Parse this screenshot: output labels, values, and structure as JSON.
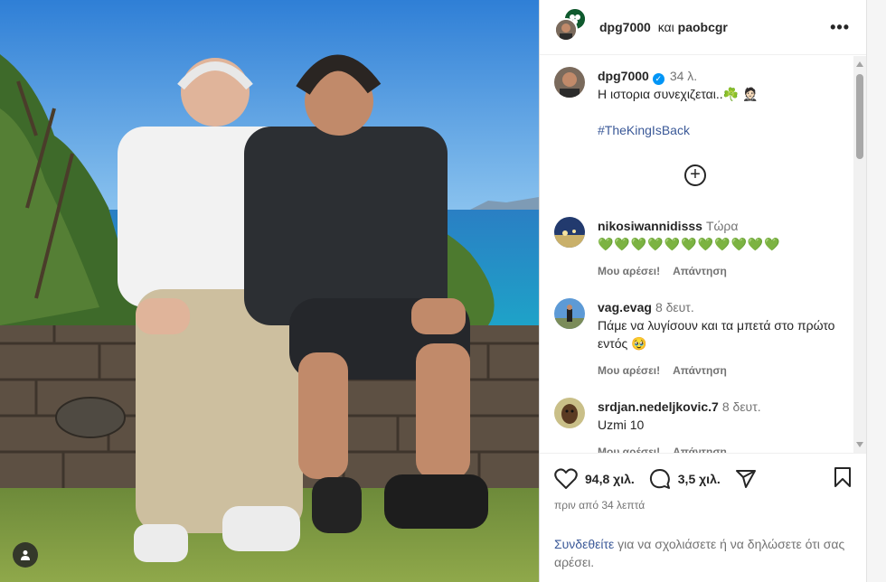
{
  "header": {
    "user1": "dpg7000",
    "conjunction": "και",
    "user2": "paobcgr"
  },
  "caption": {
    "username": "dpg7000",
    "time": "34 λ.",
    "text": "Η ιστορια συνεχιζεται..☘️ 🤵🏻",
    "hashtag": "#TheKingIsBack"
  },
  "comments": [
    {
      "username": "nikosiwannidisss",
      "time": "Τώρα",
      "text": "💚💚💚💚💚💚💚💚💚💚💚",
      "like": "Μου αρέσει!",
      "reply": "Απάντηση"
    },
    {
      "username": "vag.evag",
      "time": "8 δευτ.",
      "text": "Πάμε να λυγίσουν και τα μπετά στο πρώτο εντός 🥹",
      "like": "Μου αρέσει!",
      "reply": "Απάντηση"
    },
    {
      "username": "srdjan.nedeljkovic.7",
      "time": "8 δευτ.",
      "text": "Uzmi 10",
      "like": "Μου αρέσει!",
      "reply": "Απάντηση"
    }
  ],
  "actions": {
    "likes": "94,8 χιλ.",
    "comments": "3,5 χιλ.",
    "posted": "πριν από 34 λεπτά"
  },
  "login": {
    "link": "Συνδεθείτε",
    "text": "για να σχολιάσετε ή να δηλώσετε ότι σας αρέσει."
  },
  "colors": {
    "accent": "#0095f6",
    "link": "#3b5998",
    "heart": "#1fb36b"
  }
}
